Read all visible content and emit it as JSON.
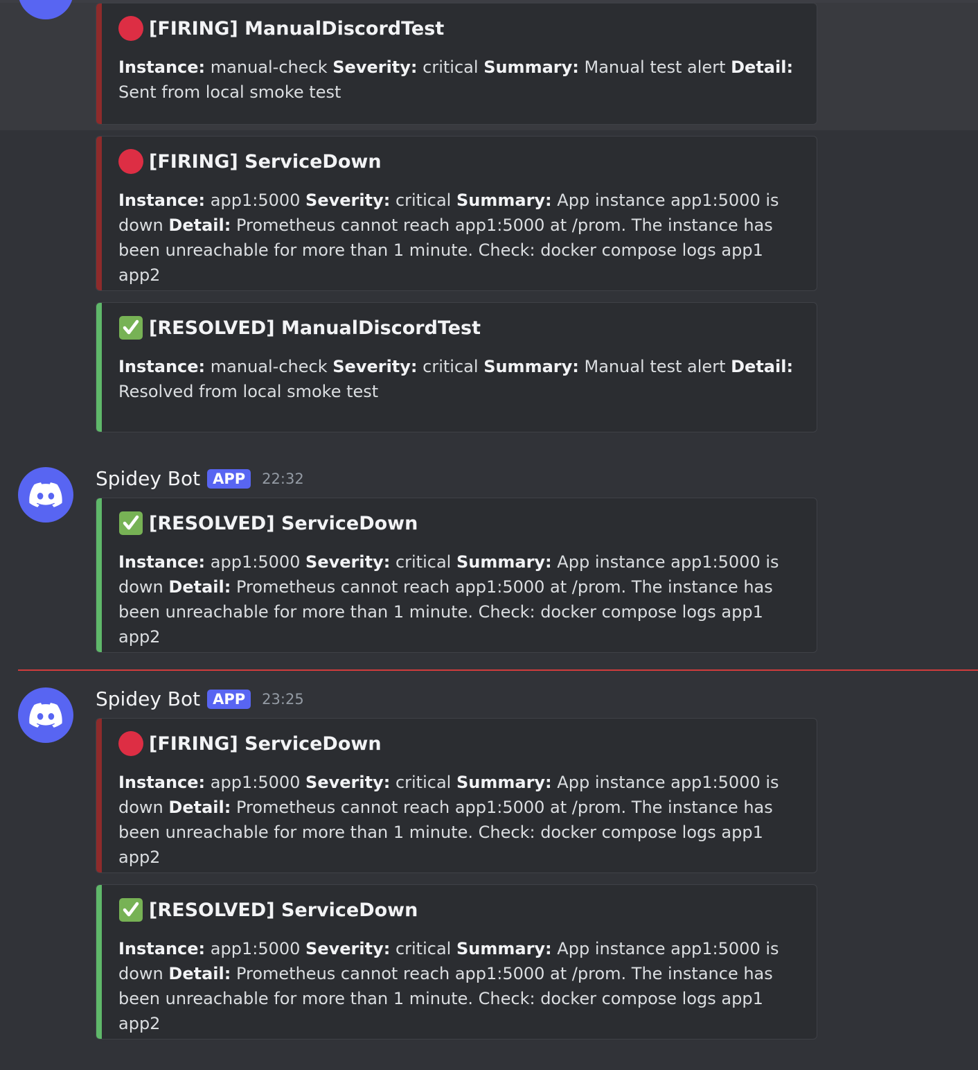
{
  "colors": {
    "background": "#313338",
    "embed_background": "#2b2d31",
    "firing_bar": "#8e2b2b",
    "resolved_bar": "#5fb86a",
    "app_badge": "#5865f2",
    "new_messages_divider": "#d13c3c",
    "avatar": "#5865f2"
  },
  "labels": {
    "instance": "Instance:",
    "severity": "Severity:",
    "summary": "Summary:",
    "detail": "Detail:"
  },
  "messages": [
    {
      "author": "Spidey Bot",
      "badge": "APP",
      "time": "22:32",
      "avatar_icon": "discord-logo-icon"
    },
    {
      "author": "Spidey Bot",
      "badge": "APP",
      "time": "23:25",
      "avatar_icon": "discord-logo-icon"
    }
  ],
  "embeds": [
    {
      "status": "firing",
      "status_icon": "red-circle-icon",
      "title": "[FIRING] ManualDiscordTest",
      "instance": "manual-check",
      "severity": "critical",
      "summary": "Manual test alert",
      "detail": "Sent from local smoke test"
    },
    {
      "status": "firing",
      "status_icon": "red-circle-icon",
      "title": "[FIRING] ServiceDown",
      "instance": "app1:5000",
      "severity": "critical",
      "summary": "App instance app1:5000 is down",
      "detail": "Prometheus cannot reach app1:5000 at /prom. The instance has been unreachable for more than 1 minute. Check: docker compose logs app1 app2"
    },
    {
      "status": "resolved",
      "status_icon": "check-mark-icon",
      "title": "[RESOLVED] ManualDiscordTest",
      "instance": "manual-check",
      "severity": "critical",
      "summary": "Manual test alert",
      "detail": "Resolved from local smoke test"
    },
    {
      "status": "resolved",
      "status_icon": "check-mark-icon",
      "title": "[RESOLVED] ServiceDown",
      "instance": "app1:5000",
      "severity": "critical",
      "summary": "App instance app1:5000 is down",
      "detail": "Prometheus cannot reach app1:5000 at /prom. The instance has been unreachable for more than 1 minute. Check: docker compose logs app1 app2"
    },
    {
      "status": "firing",
      "status_icon": "red-circle-icon",
      "title": "[FIRING] ServiceDown",
      "instance": "app1:5000",
      "severity": "critical",
      "summary": "App instance app1:5000 is down",
      "detail": "Prometheus cannot reach app1:5000 at /prom. The instance has been unreachable for more than 1 minute. Check: docker compose logs app1 app2"
    },
    {
      "status": "resolved",
      "status_icon": "check-mark-icon",
      "title": "[RESOLVED] ServiceDown",
      "instance": "app1:5000",
      "severity": "critical",
      "summary": "App instance app1:5000 is down",
      "detail": "Prometheus cannot reach app1:5000 at /prom. The instance has been unreachable for more than 1 minute. Check: docker compose logs app1 app2"
    }
  ]
}
